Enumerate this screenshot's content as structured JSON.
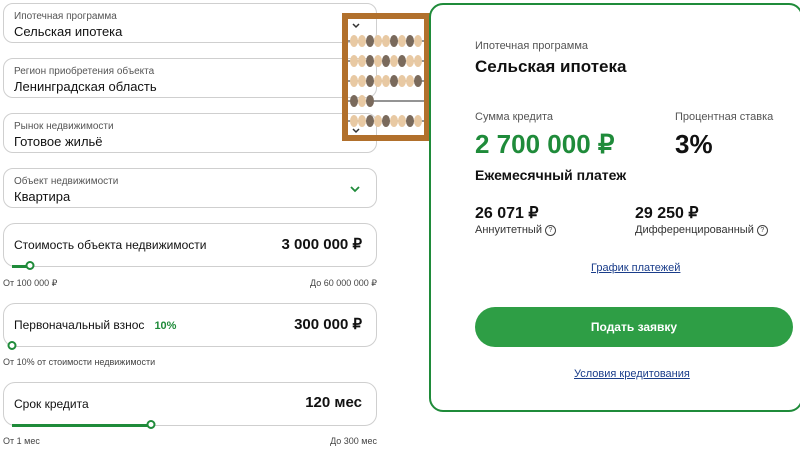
{
  "form": {
    "program": {
      "label": "Ипотечная программа",
      "value": "Сельская ипотека"
    },
    "region": {
      "label": "Регион приобретения объекта",
      "value": "Ленинградская область"
    },
    "market": {
      "label": "Рынок недвижимости",
      "value": "Готовое жильё"
    },
    "object": {
      "label": "Объект недвижимости",
      "value": "Квартира"
    },
    "cost": {
      "label": "Стоимость объекта недвижимости",
      "value": "3 000 000 ₽",
      "level": 0.05,
      "min": "От 100 000 ₽",
      "max": "До 60 000 000 ₽"
    },
    "down": {
      "label": "Первоначальный взнос",
      "percent": "10%",
      "value": "300 000 ₽",
      "level": 0.0,
      "min": "От 10% от стоимости недвижимости"
    },
    "term": {
      "label": "Срок кредита",
      "value": "120 мес",
      "level": 0.39,
      "min": "От 1 мес",
      "max": "До 300 мес"
    }
  },
  "result": {
    "program_label": "Ипотечная программа",
    "program_value": "Сельская ипотека",
    "loan_label": "Сумма кредита",
    "loan_value": "2 700 000 ₽",
    "rate_label": "Процентная ставка",
    "rate_value": "3%",
    "monthly_title": "Ежемесячный платеж",
    "annuity_value": "26 071 ₽",
    "annuity_label": "Аннуитетный",
    "diff_value": "29 250 ₽",
    "diff_label": "Дифференцированный",
    "schedule_link": "График платежей",
    "submit": "Подать заявку",
    "terms_link": "Условия кредитования"
  },
  "colors": {
    "accent": "#1f8b3a",
    "button": "#2e9e45",
    "abacus_frame": "#b1702c"
  }
}
